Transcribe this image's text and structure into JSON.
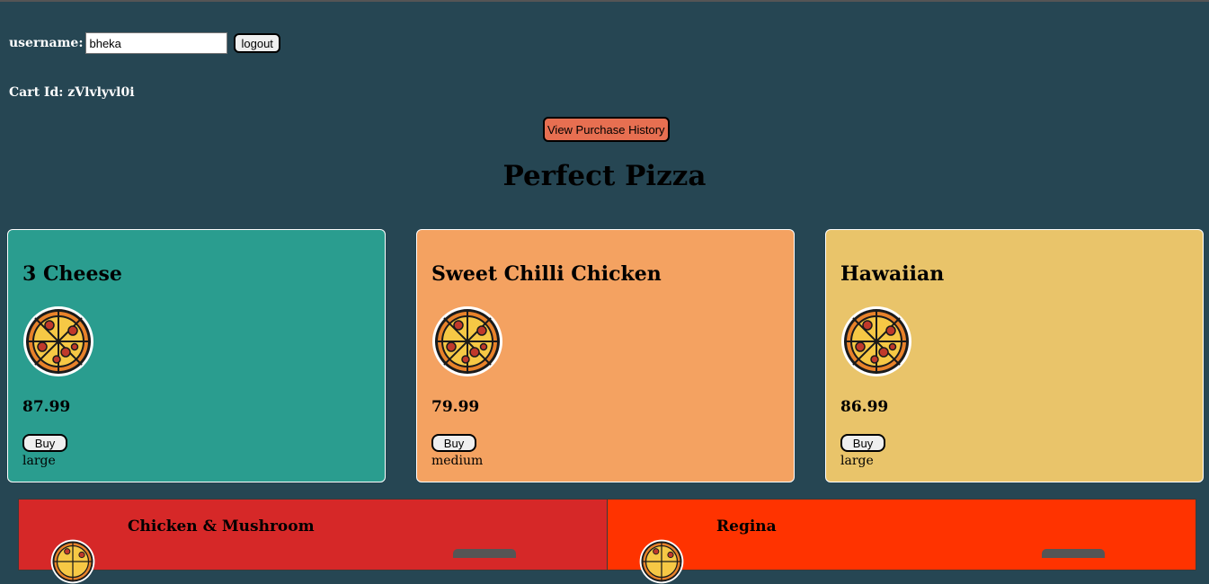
{
  "user": {
    "username_label": "username:",
    "username_value": "bheka",
    "logout_label": "logout"
  },
  "cart": {
    "text": "Cart Id: zVlvlyvl0i"
  },
  "history_button_label": "View Purchase History",
  "page_title": "Perfect Pizza",
  "pizzas": [
    {
      "name": "3 Cheese",
      "price": "87.99",
      "buy_label": "Buy",
      "size": "large",
      "color": "#2a9d8f"
    },
    {
      "name": "Sweet Chilli Chicken",
      "price": "79.99",
      "buy_label": "Buy",
      "size": "medium",
      "color": "#f4a261"
    },
    {
      "name": "Hawaiian",
      "price": "86.99",
      "buy_label": "Buy",
      "size": "large",
      "color": "#e9c46a"
    }
  ],
  "featured": [
    {
      "name": "Chicken & Mushroom",
      "color": "#d62828"
    },
    {
      "name": "Regina",
      "color": "#ff3300"
    }
  ],
  "icons": {
    "pizza": "pizza-icon"
  }
}
